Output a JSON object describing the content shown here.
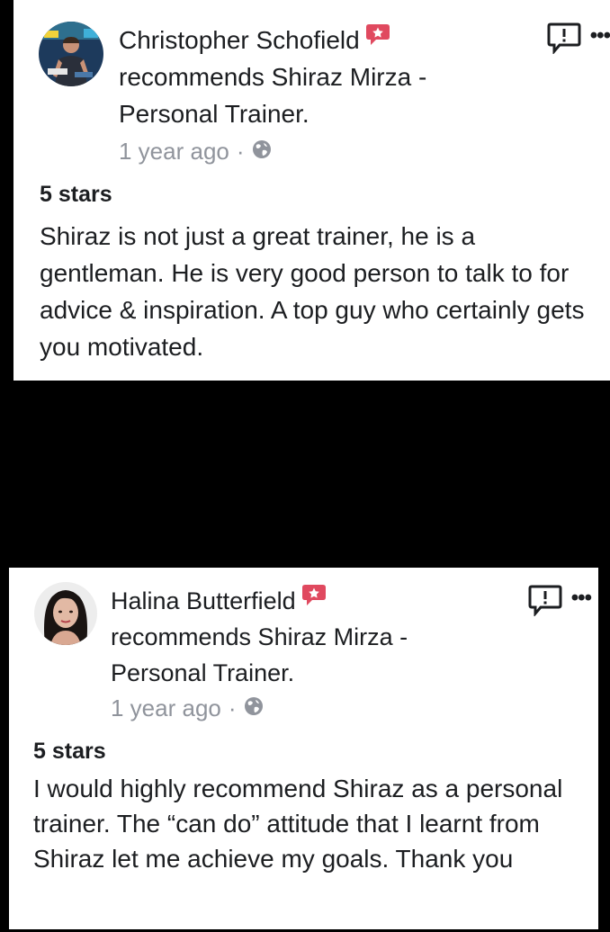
{
  "reviews": [
    {
      "reviewer": "Christopher Schofield",
      "action": "recommends Shiraz Mirza - Personal Trainer.",
      "time": "1 year ago",
      "separator": "·",
      "audience_icon": "globe-icon",
      "rating": "5 stars",
      "text": "Shiraz is not just a great trainer, he is a gentleman. He is very good person to talk to for advice & inspiration. A top guy who certainly gets you motivated.",
      "more_label": "•••"
    },
    {
      "reviewer": "Halina Butterfield",
      "action": "recommends Shiraz Mirza - Personal Trainer.",
      "time": "1 year ago",
      "separator": "·",
      "audience_icon": "globe-icon",
      "rating": "5 stars",
      "text": "I would highly recommend Shiraz as a personal trainer. The “can do” attitude that I learnt from Shiraz let me achieve my goals. Thank you",
      "more_label": "•••"
    }
  ],
  "colors": {
    "recommend_badge": "#e0495f",
    "meta_text": "#90949c",
    "body_text": "#1c1e21",
    "background": "#000000"
  }
}
